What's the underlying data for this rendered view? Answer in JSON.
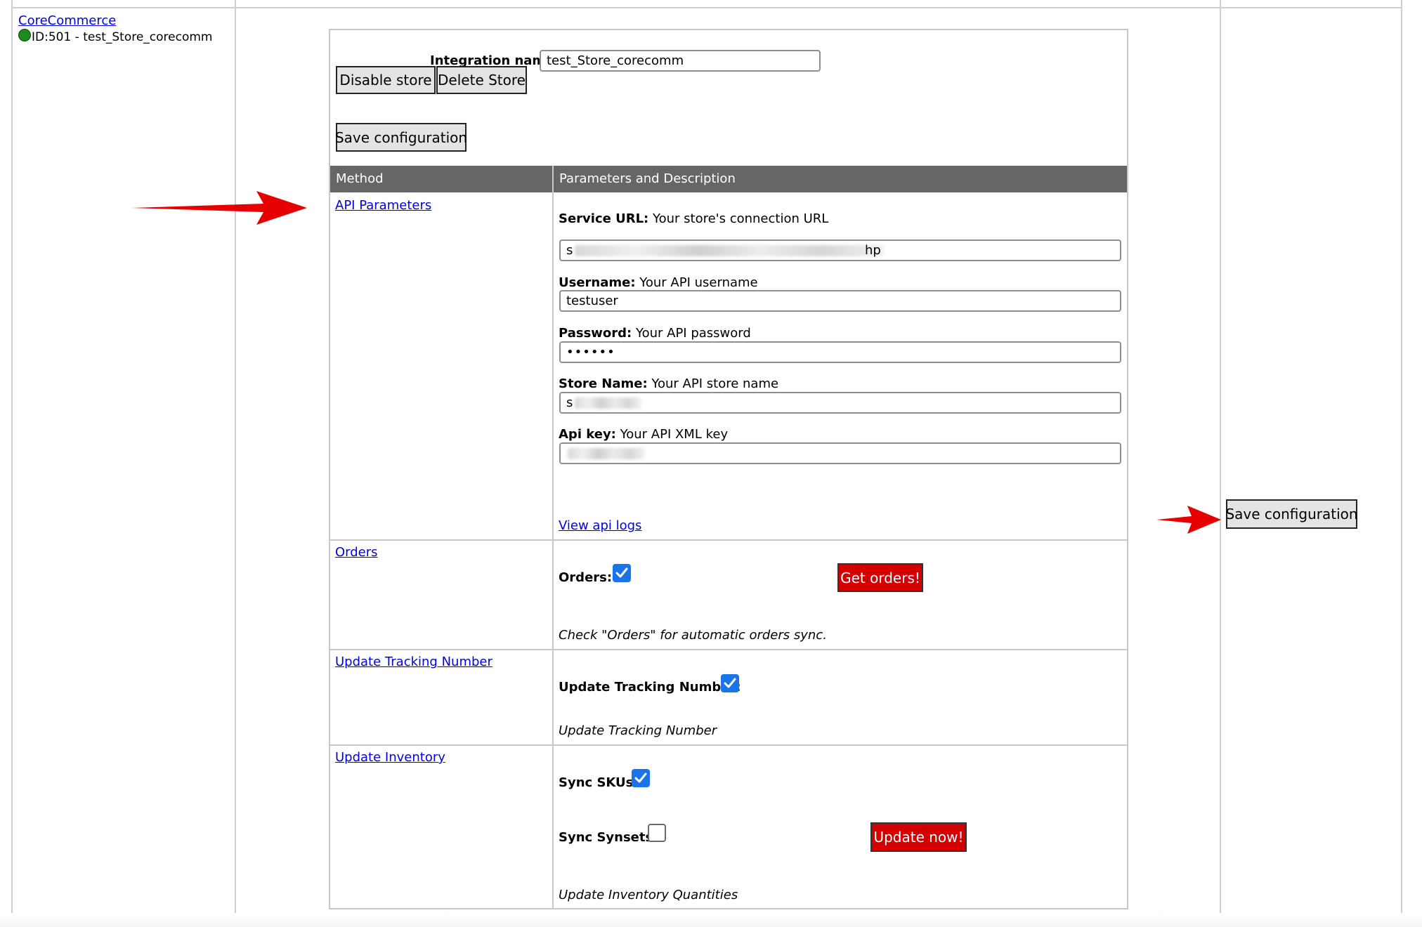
{
  "store_list": {
    "platform_link": "CoreCommerce",
    "store_line": "ID:501 - test_Store_corecomm",
    "status_color": "#1e8a1e"
  },
  "header_form": {
    "integration_name_label": "Integration name:",
    "integration_name_value": "test_Store_corecomm",
    "disable_store_label": "Disable store",
    "delete_store_label": "Delete Store",
    "save_config_label": "Save configuration"
  },
  "table": {
    "col_method": "Method",
    "col_params": "Parameters and Description"
  },
  "api_parameters": {
    "method_link": "API Parameters",
    "service_url_label": "Service URL:",
    "service_url_desc": "Your store's connection URL",
    "service_url_prefix": "s",
    "service_url_suffix": "hp",
    "username_label": "Username:",
    "username_desc": "Your API username",
    "username_value": "testuser",
    "password_label": "Password:",
    "password_desc": "Your API password",
    "password_value": "••••••",
    "store_name_label": "Store Name:",
    "store_name_desc": "Your API store name",
    "store_name_prefix": "s",
    "api_key_label": "Api key:",
    "api_key_desc": "Your API XML key",
    "view_logs_link": "View api logs"
  },
  "orders": {
    "method_link": "Orders",
    "orders_label": "Orders:",
    "orders_checked": true,
    "get_orders_button": "Get orders!",
    "description": "Check \"Orders\" for automatic orders sync."
  },
  "tracking": {
    "method_link": "Update Tracking Number",
    "label": "Update Tracking Number:",
    "checked": true,
    "description": "Update Tracking Number"
  },
  "inventory": {
    "method_link": "Update Inventory",
    "sync_skus_label": "Sync SKUs:",
    "sync_skus_checked": true,
    "sync_synsets_label": "Sync Synsets:",
    "sync_synsets_checked": false,
    "update_now_button": "Update now!",
    "description": "Update Inventory Quantities"
  },
  "side_panel": {
    "save_config_label": "Save configuration"
  },
  "colors": {
    "accent_red": "#d40000",
    "header_gray": "#666666",
    "link_blue": "#0000ee",
    "checkbox_blue": "#1a73e8",
    "arrow_red": "#e60000"
  }
}
